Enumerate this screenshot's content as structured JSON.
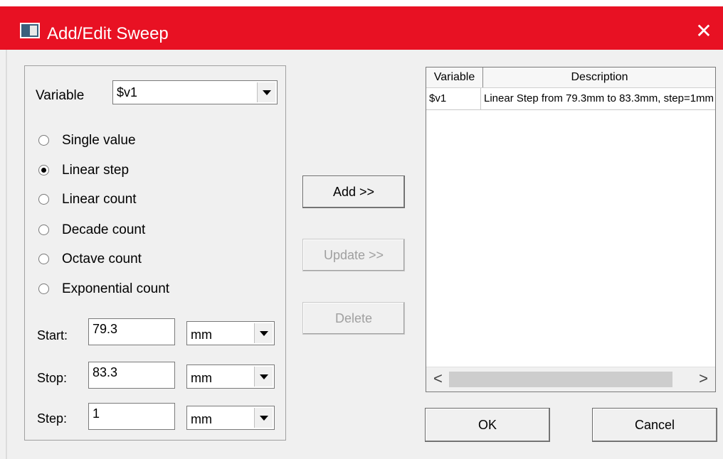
{
  "window": {
    "title": "Add/Edit Sweep",
    "close_glyph": "✕",
    "accent": "#e81123"
  },
  "variable": {
    "label": "Variable",
    "selected": "$v1"
  },
  "sweep_types": [
    {
      "label": "Single value",
      "checked": false
    },
    {
      "label": "Linear step",
      "checked": true
    },
    {
      "label": "Linear count",
      "checked": false
    },
    {
      "label": "Decade count",
      "checked": false
    },
    {
      "label": "Octave count",
      "checked": false
    },
    {
      "label": "Exponential count",
      "checked": false
    }
  ],
  "fields": {
    "start": {
      "label": "Start:",
      "value": "79.3",
      "unit": "mm"
    },
    "stop": {
      "label": "Stop:",
      "value": "83.3",
      "unit": "mm"
    },
    "step": {
      "label": "Step:",
      "value": "1",
      "unit": "mm"
    }
  },
  "buttons": {
    "add": "Add >>",
    "update": "Update >>",
    "delete": "Delete",
    "ok": "OK",
    "cancel": "Cancel"
  },
  "sweep_list": {
    "columns": [
      "Variable",
      "Description"
    ],
    "rows": [
      {
        "variable": "$v1",
        "description": "Linear Step from 79.3mm to 83.3mm, step=1mm"
      }
    ],
    "scroll_left": "<",
    "scroll_right": ">"
  }
}
